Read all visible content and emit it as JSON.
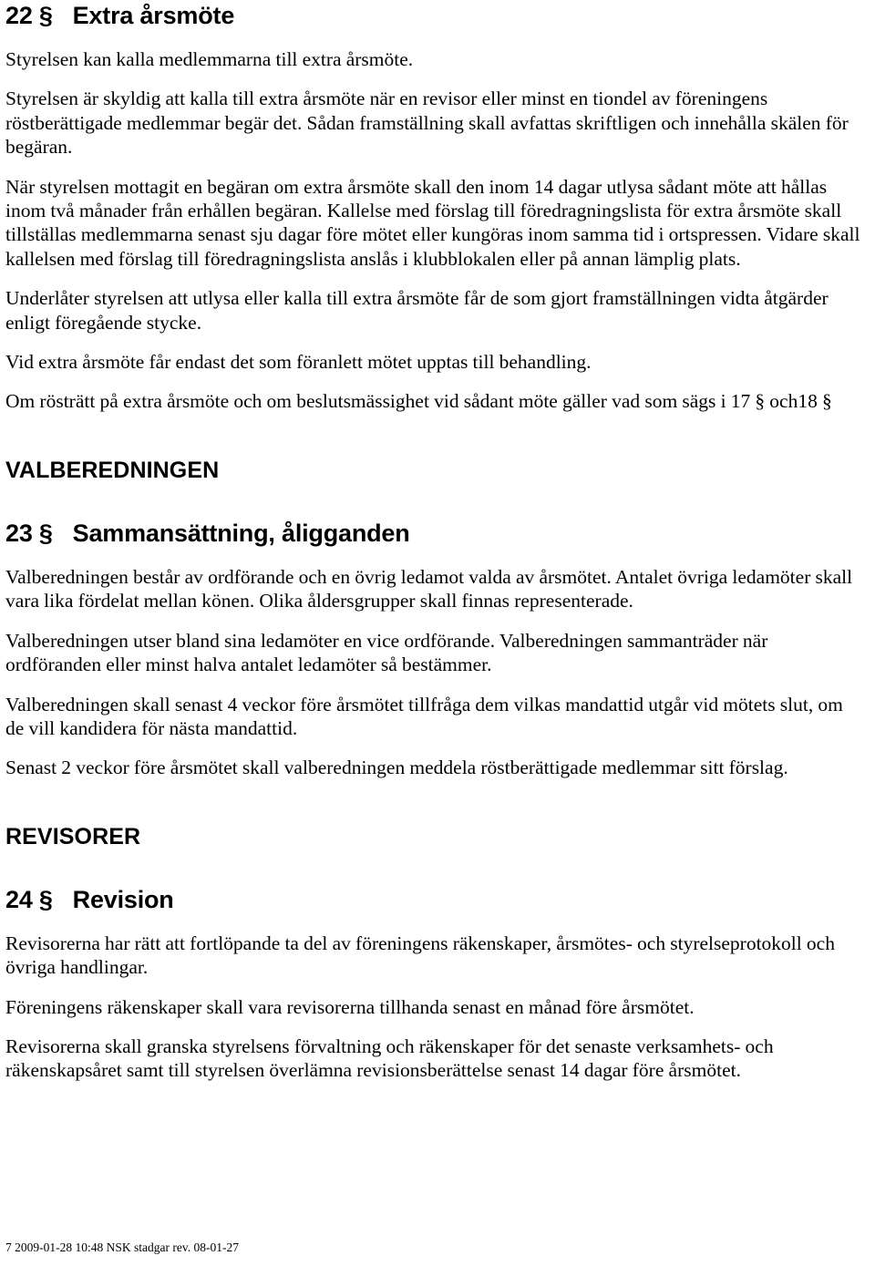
{
  "document": {
    "title": "NSK stadgar",
    "page_number": "7"
  },
  "sections": {
    "s22": {
      "heading": "22 §   Extra årsmöte",
      "paragraphs": [
        "Styrelsen kan kalla medlemmarna till extra årsmöte.",
        "Styrelsen är skyldig att kalla till extra årsmöte när en revisor eller minst en tiondel av föreningens röstberättigade medlemmar begär det. Sådan framställning skall avfattas skriftligen och innehålla skälen för begäran.",
        "När styrelsen mottagit en begäran om extra årsmöte skall den inom 14 dagar utlysa sådant möte att hållas inom två månader från erhållen begäran. Kallelse med förslag till föredragningslista för extra årsmöte skall tillställas medlemmarna senast sju dagar före mötet eller kungöras inom samma tid i ortspressen. Vidare skall kallelsen med förslag till föredragningslista anslås i klubblokalen eller på annan lämplig plats.",
        "Underlåter styrelsen att utlysa eller kalla till extra årsmöte får de som gjort framställningen vidta åtgärder enligt föregående stycke.",
        "Vid extra årsmöte får endast det som föranlett mötet upptas till behandling.",
        "Om rösträtt på extra årsmöte och om beslutsmässighet vid sådant möte gäller vad som sägs i 17 § och18 §"
      ]
    },
    "valberedningen": {
      "heading": "VALBEREDNINGEN"
    },
    "s23": {
      "heading": "23 §   Sammansättning, åligganden",
      "paragraphs": [
        "Valberedningen består av ordförande och en övrig ledamot valda av årsmötet. Antalet övriga ledamöter skall vara lika fördelat mellan könen. Olika åldersgrupper skall finnas representerade.",
        "Valberedningen utser bland sina ledamöter en vice ordförande. Valberedningen sammanträder när ordföranden eller minst halva antalet ledamöter så bestämmer.",
        "Valberedningen skall senast 4 veckor före årsmötet tillfråga dem vilkas mandattid utgår vid mötets slut, om de vill kandidera för nästa mandattid.",
        "Senast 2 veckor före årsmötet skall valberedningen meddela röstberättigade medlemmar sitt förslag."
      ]
    },
    "revisorer": {
      "heading": "REVISORER"
    },
    "s24": {
      "heading": "24 §   Revision",
      "paragraphs": [
        "Revisorerna har rätt att fortlöpande ta del av föreningens räkenskaper, årsmötes- och styrelseprotokoll och övriga handlingar.",
        "Föreningens räkenskaper skall vara revisorerna tillhanda senast en månad före årsmötet.",
        "Revisorerna skall granska styrelsens förvaltning och räkenskaper för det senaste verksamhets- och räkenskapsåret samt till styrelsen överlämna revisionsberättelse senast 14 dagar före årsmötet."
      ]
    }
  },
  "footer": {
    "text": "7 2009-01-28 10:48 NSK stadgar rev. 08-01-27"
  },
  "colors": {
    "text": "#000000",
    "background": "#ffffff"
  }
}
